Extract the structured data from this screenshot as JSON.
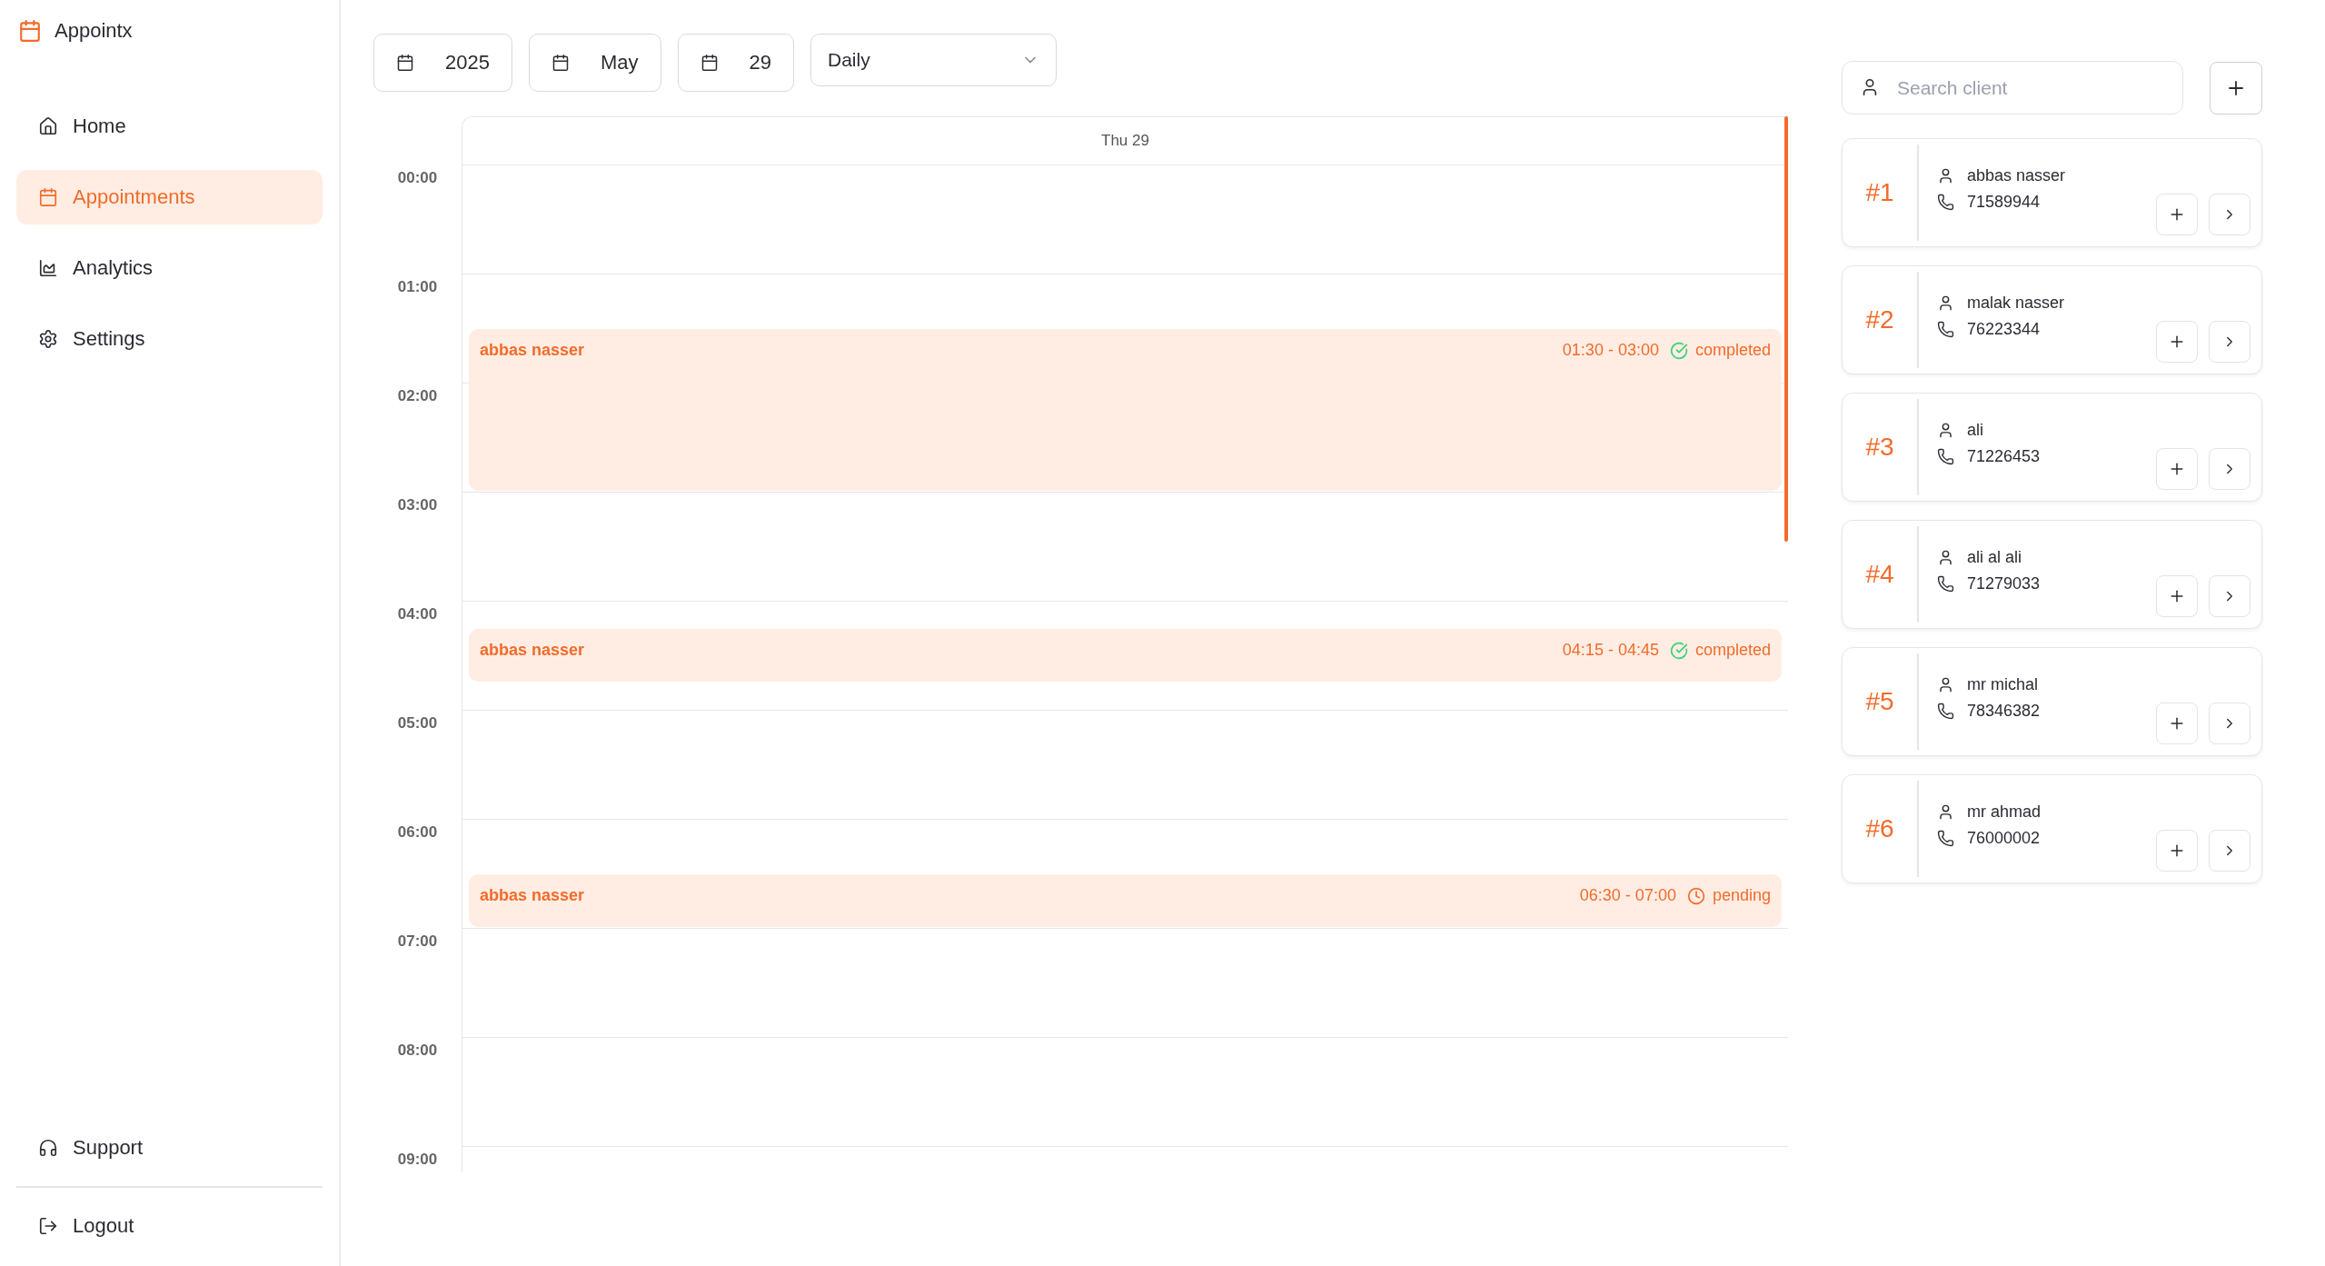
{
  "app": {
    "name": "Appointx"
  },
  "nav": [
    {
      "label": "Home",
      "kind": "home",
      "selected": false
    },
    {
      "label": "Appointments",
      "kind": "appointments",
      "selected": true
    },
    {
      "label": "Analytics",
      "kind": "analytics",
      "selected": false
    },
    {
      "label": "Settings",
      "kind": "settings",
      "selected": false
    }
  ],
  "footer_nav": [
    {
      "label": "Support",
      "kind": "support"
    },
    {
      "label": "Logout",
      "kind": "logout"
    }
  ],
  "toolbar": {
    "year": "2025",
    "month": "May",
    "day": "29",
    "view": "Daily"
  },
  "calendar": {
    "day_header": "Thu 29",
    "hours": [
      "00:00",
      "01:00",
      "02:00",
      "03:00",
      "04:00",
      "05:00",
      "06:00",
      "07:00",
      "08:00",
      "09:00"
    ],
    "appointments": [
      {
        "client": "abbas nasser",
        "time": "01:30 - 03:00",
        "status": "completed",
        "kind": "completed"
      },
      {
        "client": "abbas nasser",
        "time": "04:15 - 04:45",
        "status": "completed",
        "kind": "completed"
      },
      {
        "client": "abbas nasser",
        "time": "06:30 - 07:00",
        "status": "pending",
        "kind": "pending"
      }
    ]
  },
  "clients": {
    "search": {
      "placeholder": "Search client"
    },
    "list": [
      {
        "number": "#1",
        "name": "abbas nasser",
        "phone": "71589944"
      },
      {
        "number": "#2",
        "name": "malak nasser",
        "phone": "76223344"
      },
      {
        "number": "#3",
        "name": "ali",
        "phone": "71226453"
      },
      {
        "number": "#4",
        "name": "ali al ali",
        "phone": "71279033"
      },
      {
        "number": "#5",
        "name": "mr michal",
        "phone": "78346382"
      },
      {
        "number": "#6",
        "name": "mr ahmad",
        "phone": "76000002"
      }
    ]
  }
}
